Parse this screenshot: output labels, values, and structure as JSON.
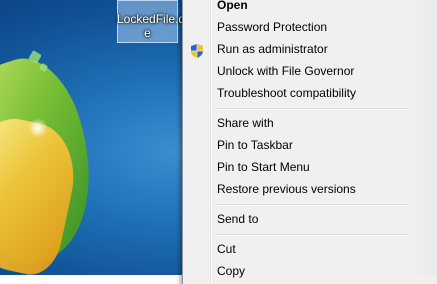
{
  "desktop": {
    "file_label": "LockedFile.d\ne"
  },
  "context_menu": {
    "items": [
      {
        "label": "Open",
        "bold": true
      },
      {
        "label": "Password Protection"
      },
      {
        "label": "Run as administrator",
        "icon": "uac-shield-icon"
      },
      {
        "label": "Unlock with File Governor"
      },
      {
        "label": "Troubleshoot compatibility"
      },
      {
        "label": "Share with",
        "submenu": true
      },
      {
        "label": "Pin to Taskbar"
      },
      {
        "label": "Pin to Start Menu"
      },
      {
        "label": "Restore previous versions"
      },
      {
        "label": "Send to",
        "submenu": true
      },
      {
        "label": "Cut"
      },
      {
        "label": "Copy"
      }
    ]
  },
  "colors": {
    "menu_background": "#f0f0f0",
    "desktop_blue": "#1f6fb4"
  }
}
